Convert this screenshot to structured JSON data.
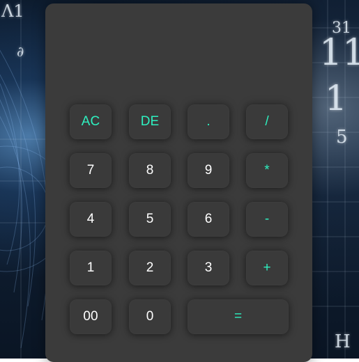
{
  "display": {
    "value": ""
  },
  "buttons": {
    "row1": [
      "AC",
      "DE",
      ".",
      "/"
    ],
    "row2": [
      "7",
      "8",
      "9",
      "*"
    ],
    "row3": [
      "4",
      "5",
      "6",
      "-"
    ],
    "row4": [
      "1",
      "2",
      "3",
      "+"
    ],
    "row5": [
      "00",
      "0",
      "="
    ]
  },
  "background": {
    "glyphs": [
      "Λ1",
      "31",
      "11",
      "1",
      "5",
      "H",
      "∂"
    ]
  },
  "colors": {
    "panel": "#3b3b3b",
    "button": "#3a3a3a",
    "digit_text": "#ffffff",
    "operator_text": "#2ef0c0"
  }
}
